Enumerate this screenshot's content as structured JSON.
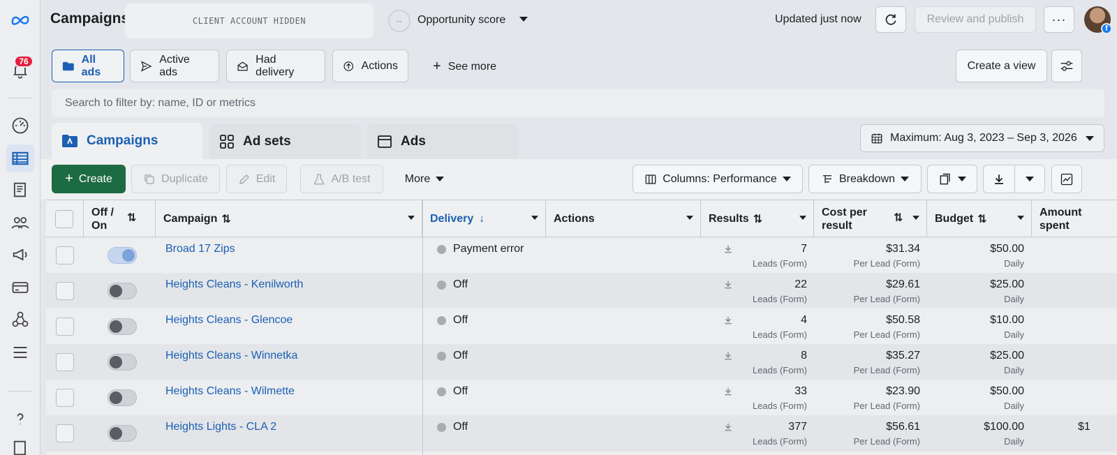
{
  "app": {
    "title": "Campaigns",
    "hidden_account": "CLIENT ACCOUNT HIDDEN",
    "opportunity_score_value": "--",
    "opportunity_score_label": "Opportunity score",
    "updated_text": "Updated just now",
    "review_publish": "Review and publish",
    "notification_count": "76"
  },
  "filters": {
    "all_ads": "All ads",
    "active_ads": "Active ads",
    "had_delivery": "Had delivery",
    "actions": "Actions",
    "see_more": "See more",
    "create_view": "Create a view"
  },
  "search": {
    "placeholder": "Search to filter by: name, ID or metrics"
  },
  "tabs": {
    "campaigns": "Campaigns",
    "ad_sets": "Ad sets",
    "ads": "Ads"
  },
  "date_range": "Maximum: Aug 3, 2023 – Sep 3, 2026",
  "toolbar": {
    "create": "Create",
    "duplicate": "Duplicate",
    "edit": "Edit",
    "ab_test": "A/B test",
    "more": "More",
    "columns": "Columns: Performance",
    "breakdown": "Breakdown"
  },
  "columns": {
    "off_on": "Off / On",
    "campaign": "Campaign",
    "delivery": "Delivery",
    "actions": "Actions",
    "results": "Results",
    "cost_per_result": "Cost per result",
    "budget": "Budget",
    "amount_spent": "Amount spent"
  },
  "rows": [
    {
      "name": "Broad 17 Zips",
      "on": true,
      "delivery": "Payment error",
      "results": "7",
      "results_sub": "Leads (Form)",
      "cost": "$31.34",
      "cost_sub": "Per Lead (Form)",
      "budget": "$50.00",
      "budget_sub": "Daily",
      "spent": ""
    },
    {
      "name": "Heights Cleans - Kenilworth",
      "on": false,
      "delivery": "Off",
      "results": "22",
      "results_sub": "Leads (Form)",
      "cost": "$29.61",
      "cost_sub": "Per Lead (Form)",
      "budget": "$25.00",
      "budget_sub": "Daily",
      "spent": ""
    },
    {
      "name": "Heights Cleans - Glencoe",
      "on": false,
      "delivery": "Off",
      "results": "4",
      "results_sub": "Leads (Form)",
      "cost": "$50.58",
      "cost_sub": "Per Lead (Form)",
      "budget": "$10.00",
      "budget_sub": "Daily",
      "spent": ""
    },
    {
      "name": "Heights Cleans - Winnetka",
      "on": false,
      "delivery": "Off",
      "results": "8",
      "results_sub": "Leads (Form)",
      "cost": "$35.27",
      "cost_sub": "Per Lead (Form)",
      "budget": "$25.00",
      "budget_sub": "Daily",
      "spent": ""
    },
    {
      "name": "Heights Cleans - Wilmette",
      "on": false,
      "delivery": "Off",
      "results": "33",
      "results_sub": "Leads (Form)",
      "cost": "$23.90",
      "cost_sub": "Per Lead (Form)",
      "budget": "$50.00",
      "budget_sub": "Daily",
      "spent": ""
    },
    {
      "name": "Heights Lights - CLA 2",
      "on": false,
      "delivery": "Off",
      "results": "377",
      "results_sub": "Leads (Form)",
      "cost": "$56.61",
      "cost_sub": "Per Lead (Form)",
      "budget": "$100.00",
      "budget_sub": "Daily",
      "spent": "$1"
    }
  ],
  "colors": {
    "accent": "#1b5fb3",
    "create_green": "#1d6b42",
    "badge_red": "#e41e3f"
  }
}
